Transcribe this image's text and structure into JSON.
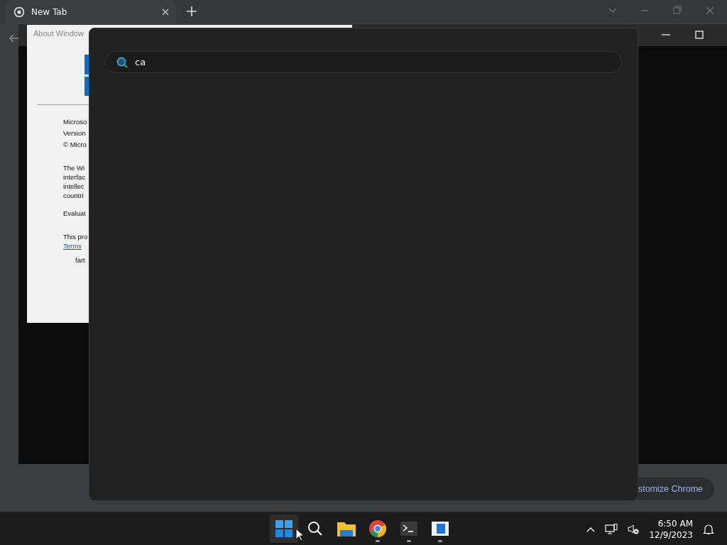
{
  "browser": {
    "tabs": [
      {
        "label": "New Tab",
        "selected": true
      }
    ],
    "customize_button": "stomize Chrome"
  },
  "about_dialog": {
    "title": "About Window",
    "lines": [
      "Microso",
      "Version",
      "© Micro"
    ],
    "paragraph": [
      "The Wi",
      "interfac",
      "intellec",
      "countri"
    ],
    "evaluation": "Evaluat",
    "license": "This pro",
    "terms_link": "Terms",
    "owner": "fart"
  },
  "search": {
    "value": "ca"
  },
  "taskbar": {
    "apps": [
      {
        "kind": "start",
        "running": false,
        "selected": true
      },
      {
        "kind": "search",
        "running": false,
        "selected": false
      },
      {
        "kind": "explorer",
        "running": false,
        "selected": false
      },
      {
        "kind": "chrome",
        "running": true,
        "selected": false
      },
      {
        "kind": "terminal",
        "running": true,
        "selected": false
      },
      {
        "kind": "app",
        "running": true,
        "selected": false
      }
    ],
    "time": "6:50 AM",
    "date": "12/9/2023"
  }
}
